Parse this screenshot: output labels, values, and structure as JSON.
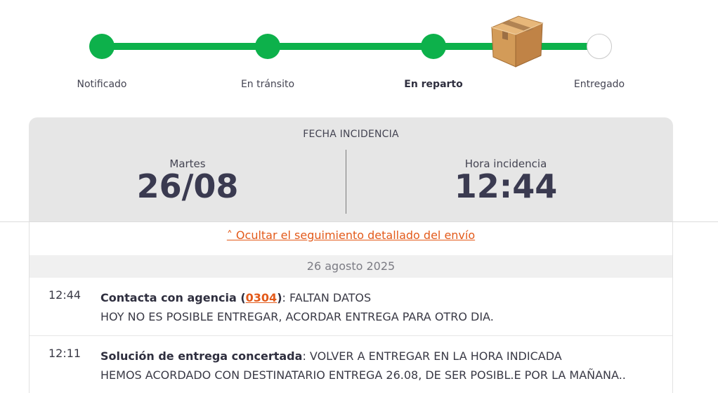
{
  "stepper": {
    "steps": [
      {
        "label": "Notificado",
        "state": "done"
      },
      {
        "label": "En tránsito",
        "state": "done"
      },
      {
        "label": "En reparto",
        "state": "current"
      },
      {
        "label": "Entregado",
        "state": "pending"
      }
    ],
    "current_icon": "package-box-icon",
    "accent_color": "#0db14b"
  },
  "incidence": {
    "title": "FECHA INCIDENCIA",
    "day_name": "Martes",
    "date": "26/08",
    "time_label": "Hora incidencia",
    "time": "12:44"
  },
  "tracking": {
    "toggle_label": "˄ Ocultar el seguimiento detallado del envío",
    "date_header": "26 agosto 2025",
    "events": [
      {
        "time": "12:44",
        "title_prefix": "Contacta con agencia (",
        "agency_code": "0304",
        "title_suffix": ")",
        "status": ": FALTAN DATOS",
        "detail": "HOY NO ES POSIBLE ENTREGAR, ACORDAR ENTREGA PARA OTRO DIA."
      },
      {
        "time": "12:11",
        "title": "Solución de entrega concertada",
        "status": ": VOLVER A ENTREGAR EN LA HORA INDICADA",
        "detail": "HEMOS ACORDADO CON DESTINATARIO ENTREGA 26.08, DE SER POSIBL.E POR LA MAÑANA.."
      }
    ],
    "link_color": "#e35a1a"
  }
}
